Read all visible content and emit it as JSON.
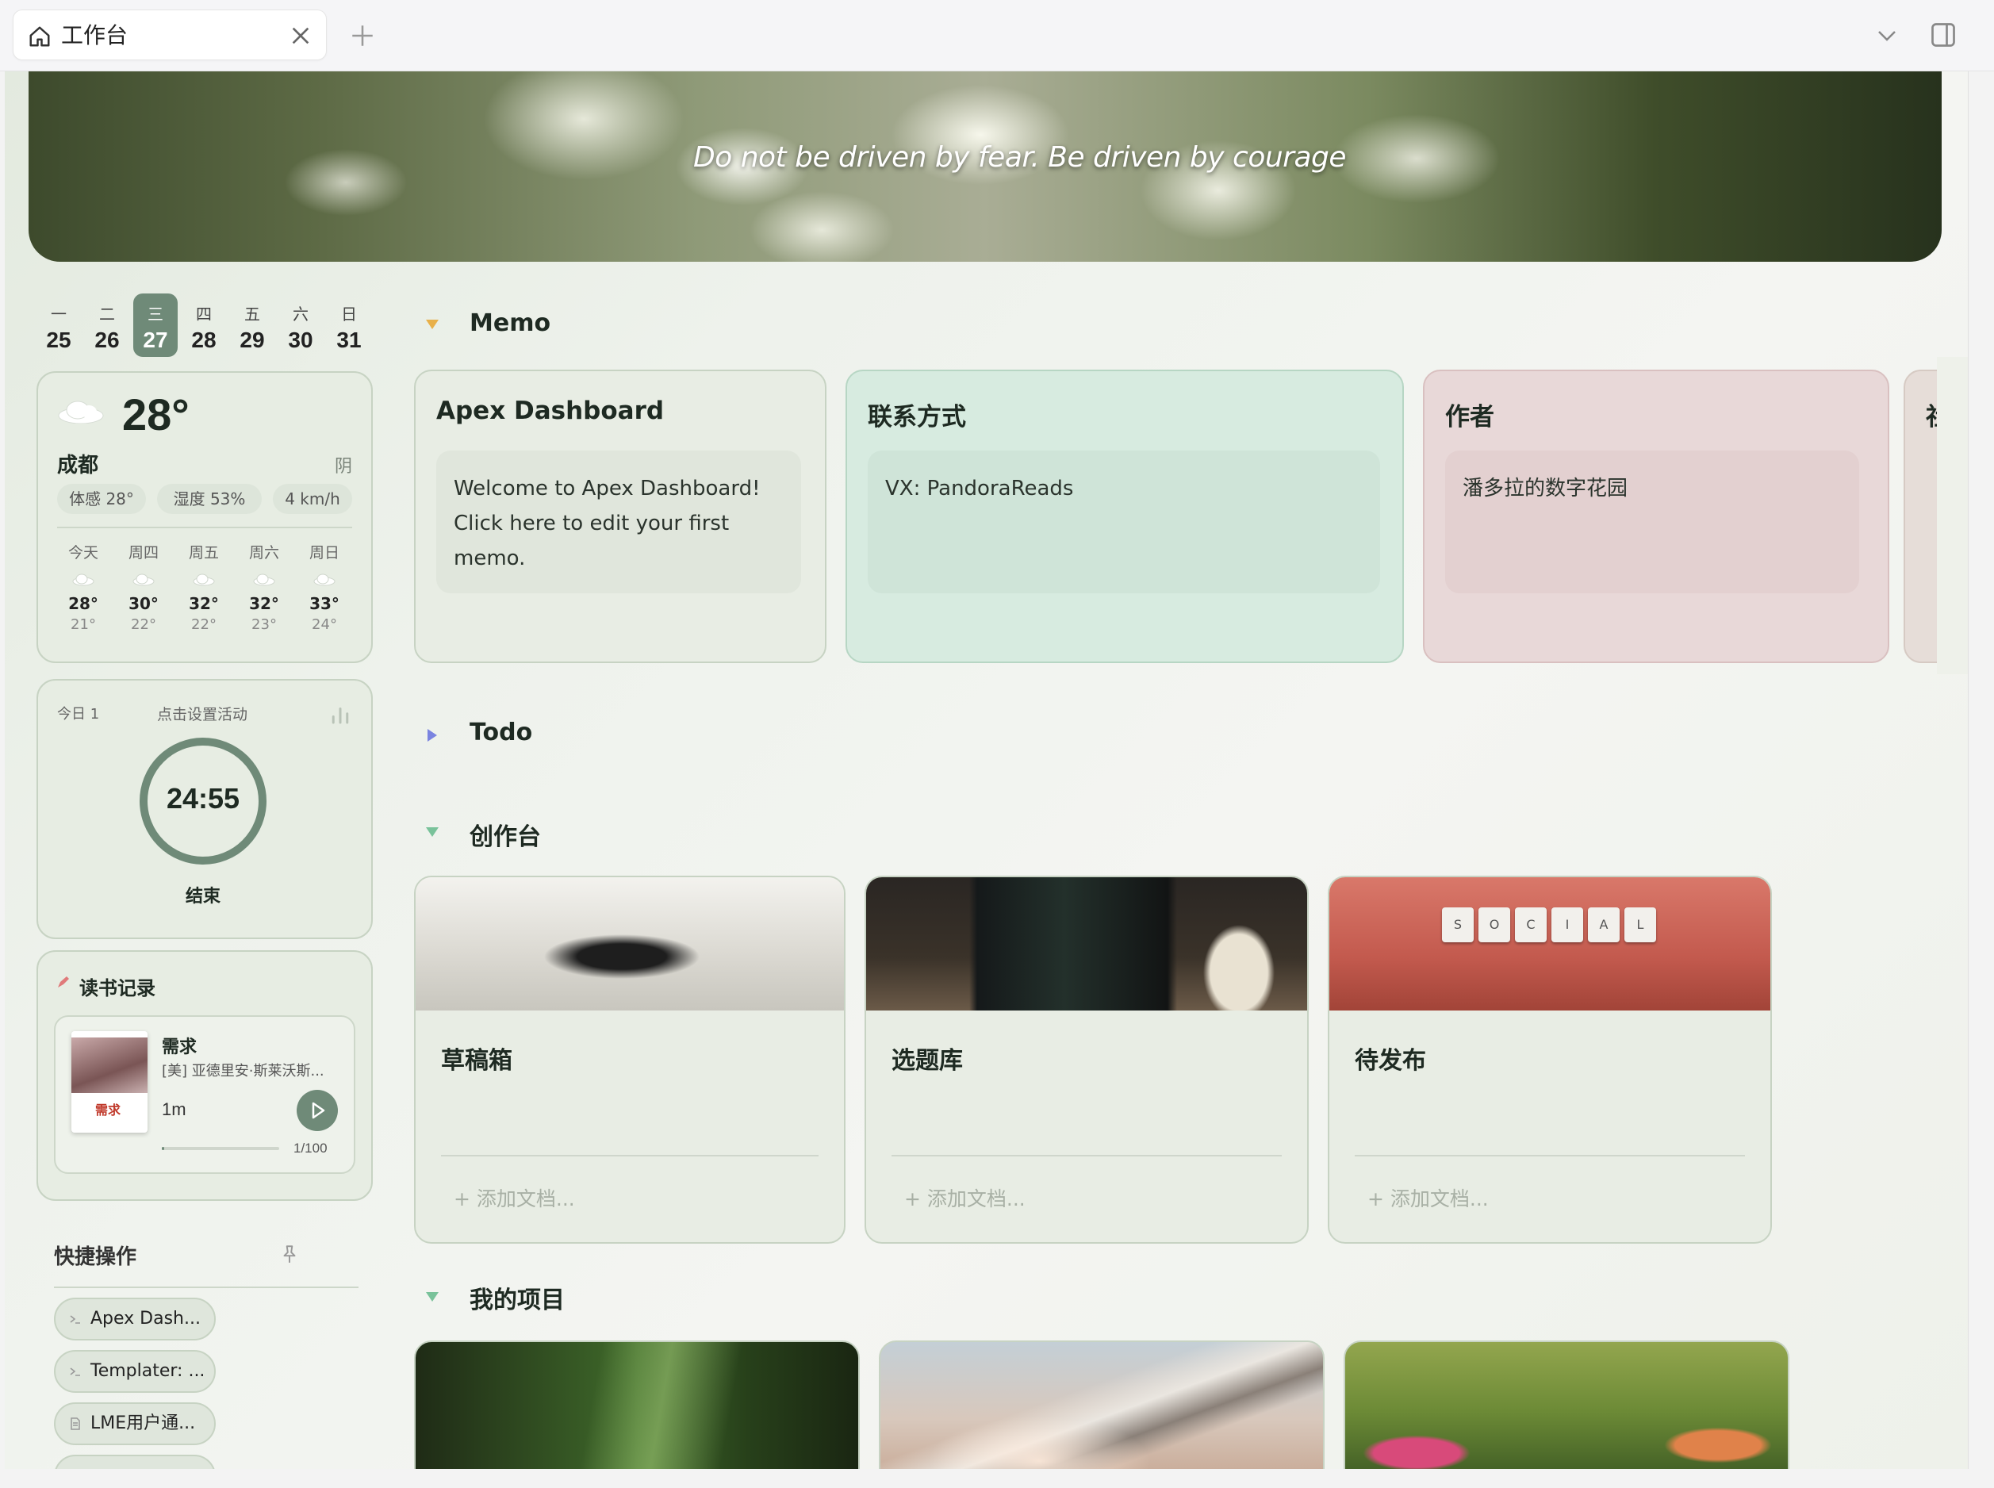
{
  "tabbar": {
    "tab_title": "工作台",
    "tab_icon": "home-icon",
    "new_tab_icon": "plus-icon",
    "tabs_menu_icon": "chevron-down-icon",
    "sidebar_toggle_icon": "sidebar-panel-icon"
  },
  "banner": {
    "quote": "Do not be driven by fear. Be driven by courage"
  },
  "calendar": {
    "days": [
      {
        "weekday": "一",
        "date": "25"
      },
      {
        "weekday": "二",
        "date": "26"
      },
      {
        "weekday": "三",
        "date": "27",
        "active": true
      },
      {
        "weekday": "四",
        "date": "28"
      },
      {
        "weekday": "五",
        "date": "29"
      },
      {
        "weekday": "六",
        "date": "30"
      },
      {
        "weekday": "日",
        "date": "31"
      }
    ]
  },
  "weather": {
    "temp": "28°",
    "city": "成都",
    "condition": "阴",
    "feels_like": "体感 28°",
    "humidity": "湿度 53%",
    "wind": "4 km/h",
    "icon": "cloud-icon",
    "forecast": [
      {
        "day": "今天",
        "high": "28°",
        "low": "21°"
      },
      {
        "day": "周四",
        "high": "30°",
        "low": "22°"
      },
      {
        "day": "周五",
        "high": "32°",
        "low": "22°"
      },
      {
        "day": "周六",
        "high": "32°",
        "low": "23°"
      },
      {
        "day": "周日",
        "high": "33°",
        "low": "24°"
      }
    ]
  },
  "timer": {
    "today_count": "今日 1",
    "hint": "点击设置活动",
    "time": "24:55",
    "end_label": "结束",
    "stats_icon": "bar-chart-icon"
  },
  "reading": {
    "title": "读书记录",
    "book_title": "需求",
    "book_author": "[美] 亚德里安·斯莱沃斯...",
    "duration": "1m",
    "progress_text": "1/100",
    "progress": 0.01,
    "cover_text": "需求"
  },
  "quick_actions": {
    "title": "快捷操作",
    "items": [
      {
        "label": "Apex Dash...",
        "icon": "terminal-icon"
      },
      {
        "label": "Templater: ...",
        "icon": "terminal-icon"
      },
      {
        "label": "LME用户通...",
        "icon": "document-icon"
      }
    ]
  },
  "sections": {
    "memo": "Memo",
    "todo": "Todo",
    "workbench": "创作台",
    "projects": "我的项目"
  },
  "memos": [
    {
      "title": "Apex Dashboard",
      "body": "Welcome to Apex Dashboard! Click here to edit your first memo.",
      "bg": "#e8ede4",
      "border": "#c7d3c3",
      "inner": "#e0e6dc"
    },
    {
      "title": "联系方式",
      "body": "VX: PandoraReads",
      "bg": "#d7ebe0",
      "border": "#b7d6c4",
      "inner": "#cfe4d8"
    },
    {
      "title": "作者",
      "body": "潘多拉的数字花园",
      "bg": "#e8d8d8",
      "border": "#d9c0c0",
      "inner": "#e3d0d0"
    },
    {
      "title": "社",
      "body": "",
      "bg": "#e6ddd8",
      "border": "#d6cac3",
      "inner": "#e0d6d0"
    }
  ],
  "workbench": [
    {
      "title": "草稿箱",
      "add": "+ 添加文档..."
    },
    {
      "title": "选题库",
      "add": "+ 添加文档..."
    },
    {
      "title": "待发布",
      "add": "+ 添加文档..."
    }
  ],
  "social_tiles": [
    "S",
    "O",
    "C",
    "I",
    "A",
    "L"
  ],
  "colors": {
    "accent": "#6f8a78",
    "memo_arrow": "#e8b04a",
    "todo_arrow": "#7a84e0",
    "section_arrow": "#79c29a"
  }
}
